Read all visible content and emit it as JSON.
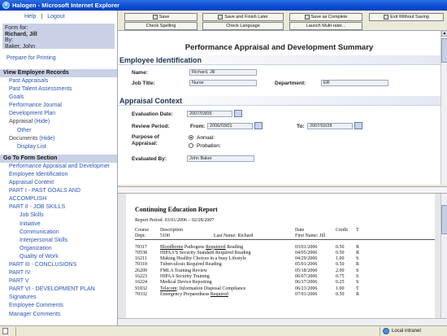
{
  "window": {
    "title": "Halogen - Microsoft Internet Explorer"
  },
  "nav": {
    "help": "Help",
    "logout": "Logout",
    "sep": "|"
  },
  "form_for": {
    "label": "Form for:",
    "name": "Richard, Jill",
    "by_label": "By:",
    "by_name": "Baker, John"
  },
  "prepare_printing": "Prepare for Printing",
  "view_records": {
    "header": "View Employee Records",
    "items": [
      {
        "label": "Past Appraisals"
      },
      {
        "label": "Past Talent Assessments"
      },
      {
        "label": "Goals"
      },
      {
        "label": "Performance Journal"
      },
      {
        "label": "Development Plan"
      }
    ],
    "appraisal": "Appraisal",
    "appraisal_toggle": "(Hide)",
    "other": "Other",
    "documents": "Documents",
    "documents_toggle": "(Hide)",
    "display_list": "Display List"
  },
  "form_sections": {
    "header": "Go To Form Section",
    "items": [
      "Performance Appraisal and Developmer",
      "Employee Identification",
      "Appraisal Context",
      "PART I - PAST GOALS AND ACCOMPLISH",
      "PART II - JOB SKILLS"
    ],
    "job_skills": [
      "Job Skills",
      "Initiative",
      "Communication",
      "Interpersonal Skills",
      "Organization",
      "Quality of Work"
    ],
    "items_after": [
      "PART III - CONCLUSIONS",
      "PART IV",
      "PART V",
      "PART VI - DEVELOPMENT PLAN",
      "Signatures",
      "Employee Comments",
      "Manager Comments"
    ]
  },
  "toolbar": {
    "save": "Save",
    "save_finish": "Save and Finish Later",
    "save_complete": "Save as Complete",
    "exit": "Exit Without Saving",
    "spelling": "Check Spelling",
    "language": "Check Language",
    "multirater": "Launch Multi-rater..."
  },
  "document": {
    "title": "Performance Appraisal and Development Summary",
    "employee_section": "Employee Identification",
    "name_label": "Name:",
    "name_value": "Richard, Jill",
    "jobtitle_label": "Job Title:",
    "jobtitle_value": "Nurse",
    "department_label": "Department:",
    "department_value": "ER",
    "context_section": "Appraisal Context",
    "eval_date_label": "Evaluation Date:",
    "eval_date_value": "2007/03/05",
    "review_label": "Review Period:",
    "from_label": "From:",
    "from_value": "2006/03/01",
    "to_label": "To:",
    "to_value": "2007/02/28",
    "purpose_label_1": "Purpose of",
    "purpose_label_2": "Appraisal:",
    "annual_label": "Annual:",
    "probation_label": "Probation:",
    "evaluated_label": "Evaluated By:",
    "evaluated_value": "John Baker",
    "purpose_selected": "Annual"
  },
  "report": {
    "title": "Continuing Education Report",
    "period": "Report Period: 03/01/2006 – 02/28/2007",
    "header": {
      "course": "Course",
      "description": "Description",
      "date": "Date",
      "credit": "Credit",
      "t": "T",
      "dept_label": "Dept:",
      "dept_value": "5100",
      "last_name": "Last Name: Richard",
      "first_name": "First Name: Jill"
    },
    "rows": [
      {
        "course": "70317",
        "desc_a": "Bloodborne",
        "desc_b": " Pathogens ",
        "desc_c": "Requiered",
        "desc_d": " Reading",
        "date": "03/01/2006",
        "credit": "0.50",
        "t": "R"
      },
      {
        "course": "70538",
        "desc_a": "HIPAA'S Security Standard Required Reading",
        "desc_b": "",
        "desc_c": "",
        "desc_d": "",
        "date": "04/05/2006",
        "credit": "0.50",
        "t": "R"
      },
      {
        "course": "16211",
        "desc_a": "Making Healthy Choices in a busy Lifestyle",
        "desc_b": "",
        "desc_c": "",
        "desc_d": "",
        "date": "04/29/2006",
        "credit": "1.00",
        "t": "S"
      },
      {
        "course": "70318",
        "desc_a": "Tuberculosis Required Reading",
        "desc_b": "",
        "desc_c": "",
        "desc_d": "",
        "date": "05/01/2006",
        "credit": "0.50",
        "t": "R"
      },
      {
        "course": "26209",
        "desc_a": "FMLA Training Review",
        "desc_b": "",
        "desc_c": "",
        "desc_d": "",
        "date": "05/18/2006",
        "credit": "2.00",
        "t": "S"
      },
      {
        "course": "16223",
        "desc_a": "HIPAA Security Training",
        "desc_b": "",
        "desc_c": "",
        "desc_d": "",
        "date": "06/07/2006",
        "credit": "0.75",
        "t": "S"
      },
      {
        "course": "16224",
        "desc_a": "Medical Device Reporting",
        "desc_b": "",
        "desc_c": "",
        "desc_d": "",
        "date": "06/17/2006",
        "credit": "0.25",
        "t": "S"
      },
      {
        "course": "91832",
        "desc_a": "Telecom",
        "desc_b": ": Information Disposal Compliance",
        "desc_c": "",
        "desc_d": "",
        "date": "06/23/2006",
        "credit": "1.00",
        "t": "T"
      },
      {
        "course": "70332",
        "desc_a": "Emergency Preparedness ",
        "desc_b": "",
        "desc_c": "Required",
        "desc_d": "",
        "date": "07/01/2006",
        "credit": "0.50",
        "t": "R"
      }
    ]
  },
  "status": {
    "zone": "Local intranet"
  }
}
